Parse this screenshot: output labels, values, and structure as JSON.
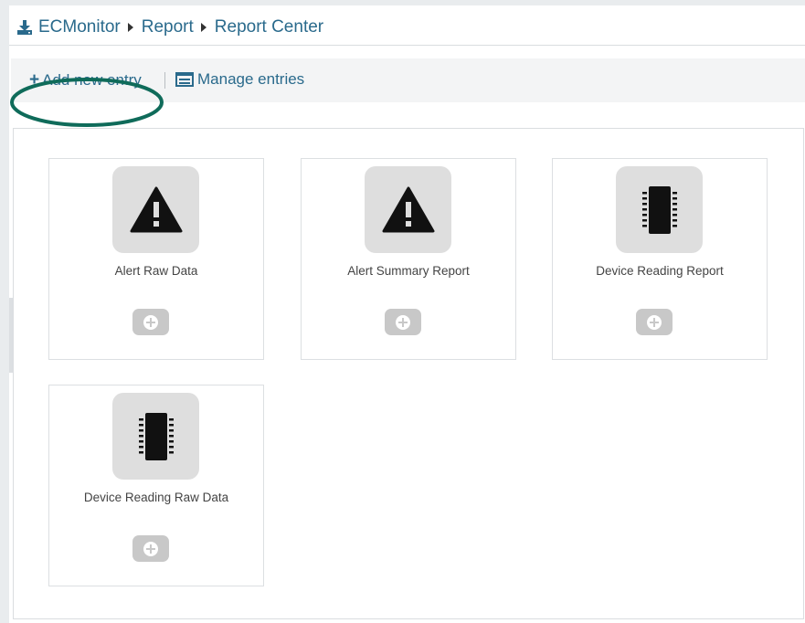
{
  "breadcrumb": {
    "items": [
      "ECMonitor",
      "Report",
      "Report Center"
    ],
    "icon": "download-icon"
  },
  "toolbar": {
    "add_label": "Add new entry",
    "manage_label": "Manage entries",
    "add_icon": "plus-icon",
    "manage_icon": "list-icon"
  },
  "reports": [
    {
      "label": "Alert Raw Data",
      "icon": "alert-triangle-icon"
    },
    {
      "label": "Alert Summary Report",
      "icon": "alert-triangle-icon"
    },
    {
      "label": "Device Reading Report",
      "icon": "chip-icon"
    },
    {
      "label": "Device Reading Raw Data",
      "icon": "chip-icon"
    }
  ],
  "colors": {
    "link": "#2a6a8c",
    "highlight": "#0f6b5a",
    "tile": "#dedede"
  }
}
